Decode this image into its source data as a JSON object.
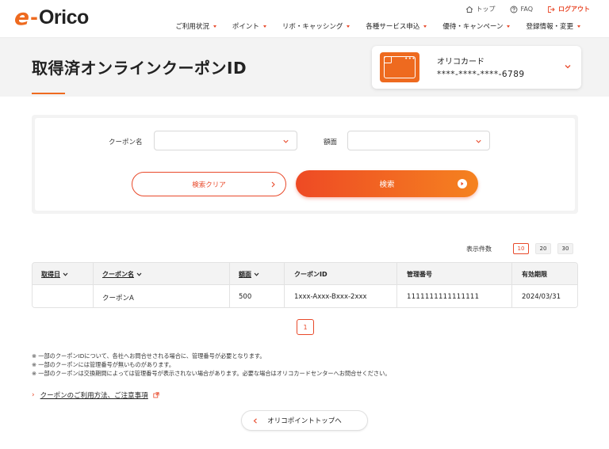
{
  "header": {
    "logo": {
      "e": "e",
      "dash": "-",
      "text": "Orico"
    },
    "util": {
      "top": "トップ",
      "faq": "FAQ",
      "logout": "ログアウト"
    },
    "nav": [
      {
        "label": "ご利用状況"
      },
      {
        "label": "ポイント"
      },
      {
        "label": "リボ・キャッシング"
      },
      {
        "label": "各種サービス申込"
      },
      {
        "label": "優待・キャンペーン"
      },
      {
        "label": "登録情報・変更"
      }
    ]
  },
  "page": {
    "title": "取得済オンラインクーポンID"
  },
  "card": {
    "name": "オリコカード",
    "number": "****-****-****-6789",
    "icon_dots": "•••"
  },
  "search": {
    "coupon_label": "クーポン名",
    "amount_label": "額面",
    "coupon_value": "",
    "amount_value": "",
    "clear_label": "検索クリア",
    "search_label": "検索"
  },
  "count": {
    "label": "表示件数",
    "options": [
      "10",
      "20",
      "30"
    ],
    "selected": "10"
  },
  "table": {
    "headers": {
      "date": "取得日",
      "name": "クーポン名",
      "amount": "額面",
      "coupon_id": "クーポンID",
      "mgmt_no": "管理番号",
      "expiry": "有効期限"
    },
    "rows": [
      {
        "date": "",
        "name": "クーポンA",
        "amount": "500",
        "coupon_id": "1xxx-Axxx-Bxxx-2xxx",
        "mgmt_no": "1111111111111111",
        "expiry": "2024/03/31"
      }
    ]
  },
  "pagination": {
    "current": "1"
  },
  "notes": [
    "※ 一部のクーポンIDについて、各社へお問合せされる場合に、管理番号が必要となります。",
    "※ 一部のクーポンには管理番号が無いものがあります。",
    "※ 一部のクーポンは交換期間によっては管理番号が表示されない場合があります。必要な場合はオリコカードセンターへお問合せください。"
  ],
  "links": {
    "usage": "クーポンのご利用方法、ご注意事項",
    "back_top": "オリコポイントトップへ"
  },
  "colors": {
    "accent": "#e8492a",
    "brand_orange": "#ee6a1f",
    "panel_gray": "#f3f3f3"
  }
}
